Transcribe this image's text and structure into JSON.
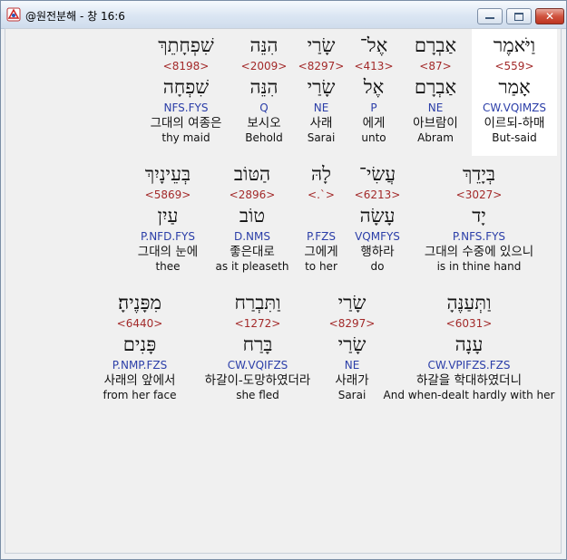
{
  "window": {
    "title": "@원전분해 - 창 16:6"
  },
  "rows": [
    {
      "words": [
        {
          "hebrew": "וַיֹּאמֶר",
          "strong": "<559>",
          "lemma": "אָמַר",
          "parse": "CW.VQIMZS",
          "korean": "이르되-하매",
          "english": "But-said"
        },
        {
          "hebrew": "אַבְרָם",
          "strong": "<87>",
          "lemma": "אַבְרָם",
          "parse": "NE",
          "korean": "아브람이",
          "english": "Abram"
        },
        {
          "hebrew": "אֶל־",
          "strong": "<413>",
          "lemma": "אֶל",
          "parse": "P",
          "korean": "에게",
          "english": "unto"
        },
        {
          "hebrew": "שָׂרַי",
          "strong": "<8297>",
          "lemma": "שָׂרַי",
          "parse": "NE",
          "korean": "사래",
          "english": "Sarai"
        },
        {
          "hebrew": "הִנֵּה",
          "strong": "<2009>",
          "lemma": "הִנֵּה",
          "parse": "Q",
          "korean": "보시오",
          "english": "Behold"
        },
        {
          "hebrew": "שִׁפְחָתֵךְ",
          "strong": "<8198>",
          "lemma": "שִׁפְחָה",
          "parse": "NFS.FYS",
          "korean": "그대의 여종은",
          "english": "thy maid"
        }
      ]
    },
    {
      "words": [
        {
          "hebrew": "בְּיָדֵךְ",
          "strong": "<3027>",
          "lemma": "יָד",
          "parse": "P.NFS.FYS",
          "korean": "그대의 수중에 있으니",
          "english": "is in thine hand"
        },
        {
          "hebrew": "עֲשִׂי־",
          "strong": "<6213>",
          "lemma": "עָשָׂה",
          "parse": "VQMFYS",
          "korean": "행하라",
          "english": "do"
        },
        {
          "hebrew": "לָהּ",
          "strong": "<.`>",
          "lemma": "",
          "parse": "P.FZS",
          "korean": "그에게",
          "english": "to her"
        },
        {
          "hebrew": "הַטּוֹב",
          "strong": "<2896>",
          "lemma": "טוֹב",
          "parse": "D.NMS",
          "korean": "좋은대로",
          "english": "as it pleaseth"
        },
        {
          "hebrew": "בְּעֵינָיִךְ",
          "strong": "<5869>",
          "lemma": "עַיִן",
          "parse": "P.NFD.FYS",
          "korean": "그대의 눈에",
          "english": "thee"
        }
      ]
    },
    {
      "words": [
        {
          "hebrew": "וַתְּעַנֶּהָ",
          "strong": "<6031>",
          "lemma": "עָנָה",
          "parse": "CW.VPIFZS.FZS",
          "korean": "하갈을 학대하였더니",
          "english": "And when-dealt hardly with her"
        },
        {
          "hebrew": "שָׂרַי",
          "strong": "<8297>",
          "lemma": "שָׂרַי",
          "parse": "NE",
          "korean": "사래가",
          "english": "Sarai"
        },
        {
          "hebrew": "וַתִּבְרַח",
          "strong": "<1272>",
          "lemma": "בָּרַח",
          "parse": "CW.VQIFZS",
          "korean": "하갈이-도망하였더라",
          "english": "she fled"
        },
        {
          "hebrew": "מִפָּנֶיהָ׃",
          "strong": "<6440>",
          "lemma": "פָּנִים",
          "parse": "P.NMP.FZS",
          "korean": "사래의 앞에서",
          "english": "from her face"
        }
      ]
    }
  ],
  "colors": {
    "strong": "#a32a2a",
    "parse": "#2b3ea8",
    "text": "#111111"
  }
}
